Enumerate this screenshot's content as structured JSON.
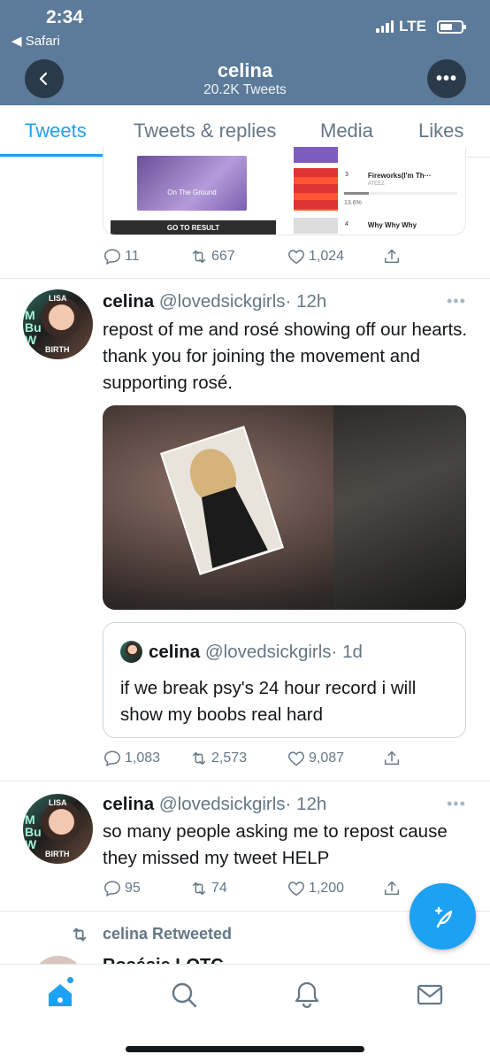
{
  "status_bar": {
    "time": "2:34",
    "back_app": "Safari",
    "network": "LTE"
  },
  "header": {
    "title": "celina",
    "subtitle": "20.2K Tweets",
    "more_label": "•••"
  },
  "tabs": [
    {
      "label": "Tweets",
      "active": true
    },
    {
      "label": "Tweets & replies",
      "active": false
    },
    {
      "label": "Media",
      "active": false
    },
    {
      "label": "Likes",
      "active": false
    }
  ],
  "prev_tweet": {
    "card": {
      "album_label": "On The Ground",
      "go_result": "GO TO RESULT",
      "chart": [
        {
          "rank": "3",
          "title": "Fireworks(I'm Th···",
          "artist": "ATEEZ",
          "percent": "13.6%"
        },
        {
          "rank": "4",
          "title": "Why Why Why"
        }
      ]
    },
    "stats": {
      "replies": "11",
      "retweets": "667",
      "likes": "1,024"
    }
  },
  "tweet1": {
    "name": "celina",
    "handle": "@lovedsickgirls",
    "time": "· 12h",
    "more": "•••",
    "avatar_text": {
      "top": "LISA",
      "bottom": "BIRTH"
    },
    "text": "repost of me and rosé showing off our hearts. thank you for joining the movement and supporting rosé.",
    "quote": {
      "name": "celina",
      "handle": "@lovedsickgirls",
      "time": "· 1d",
      "text": "if we break psy's 24 hour record i will show my boobs real hard"
    },
    "stats": {
      "replies": "1,083",
      "retweets": "2,573",
      "likes": "9,087"
    }
  },
  "tweet2": {
    "name": "celina",
    "handle": "@lovedsickgirls",
    "time": "· 12h",
    "more": "•••",
    "avatar_text": {
      "top": "LISA",
      "bottom": "BIRTH"
    },
    "text": "so many people asking me to repost cause they missed my tweet HELP",
    "stats": {
      "replies": "95",
      "retweets": "74",
      "likes": "1,200"
    }
  },
  "retweet_banner": {
    "label": "celina Retweeted",
    "next_author_partial": "Rosésie LOTC"
  },
  "colors": {
    "header_bg": "#5c7a99",
    "accent": "#1da1f2",
    "muted": "#657786"
  }
}
